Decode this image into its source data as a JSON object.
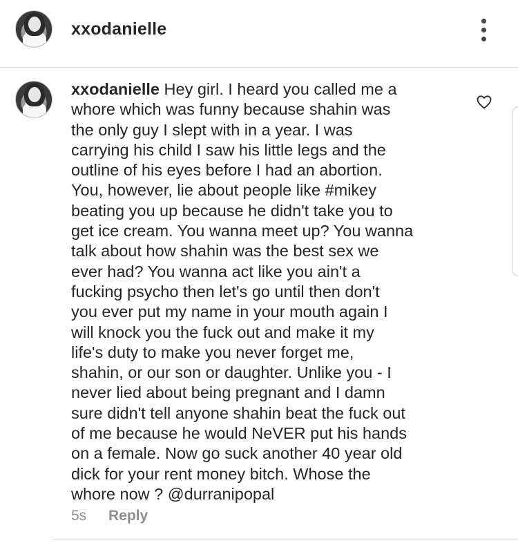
{
  "header": {
    "username": "xxodanielle",
    "avatar_icon": "profile-avatar",
    "more_icon": "more-vertical-icon"
  },
  "comment": {
    "username": "xxodanielle",
    "text": "Hey girl. I heard you called me a\nwhore which was funny because shahin was\nthe only guy I slept with in a year. I was\ncarrying his child I saw his little legs and the\noutline of his eyes before I had an abortion.\nYou, however, lie about people like #mikey\nbeating you up because he didn't take you to\nget ice cream. You wanna meet up? You wanna\ntalk about how shahin was the best sex  we\never had? You wanna act like you ain't a\nfucking psycho then let's go until then don't\nyou ever put my name in your mouth again I\nwill knock you the fuck out and make it my\nlife's duty to make you never forget me,\nshahin, or our son or daughter. Unlike you - I\nnever lied about being pregnant and I damn\nsure didn't tell anyone shahin beat the fuck out\nof me because he would NeVER put his hands\non a female. Now go suck another 40 year old\ndick for your rent money bitch. Whose the\nwhore now ? @durranipopal",
    "timestamp": "5s",
    "reply_label": "Reply",
    "like_icon": "heart-outline-icon"
  },
  "colors": {
    "text": "#262626",
    "muted": "#8e8e8e",
    "divider": "#d8d8d8"
  }
}
